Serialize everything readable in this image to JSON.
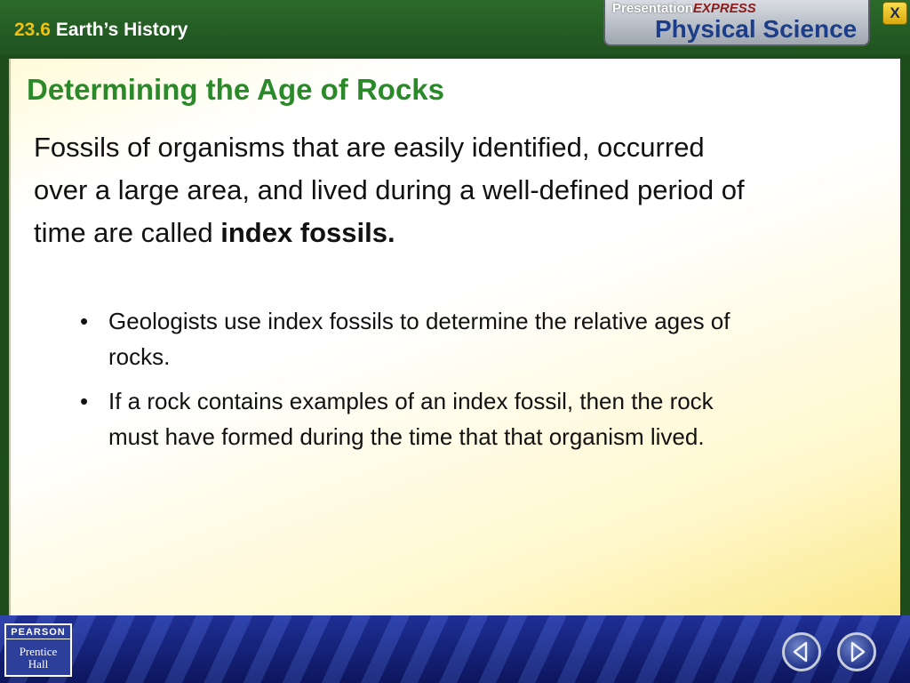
{
  "header": {
    "section_number": "23.6",
    "section_title": "Earth’s History",
    "brand_prefix": "Presentation",
    "brand_express": "EXPRESS",
    "brand_main": "Physical Science",
    "close_label": "X"
  },
  "slide": {
    "title": "Determining the Age of Rocks",
    "intro_text": "Fossils of organisms that are easily identified, occurred over a large area, and lived during a well-defined period of time are called ",
    "intro_bold": "index fossils.",
    "bullets": [
      "Geologists use index fossils to determine the relative ages of rocks.",
      "If a rock contains examples of an index fossil, then the rock must have formed during the time that that organism lived."
    ]
  },
  "footer": {
    "logo_top": "PEARSON",
    "logo_line1": "Prentice",
    "logo_line2": "Hall",
    "prev_icon": "chevron-left-icon",
    "next_icon": "chevron-right-icon"
  },
  "colors": {
    "header_green": "#1f5220",
    "title_green": "#2a8a2a",
    "section_number_yellow": "#f2c10d",
    "footer_blue": "#1a2a90"
  }
}
